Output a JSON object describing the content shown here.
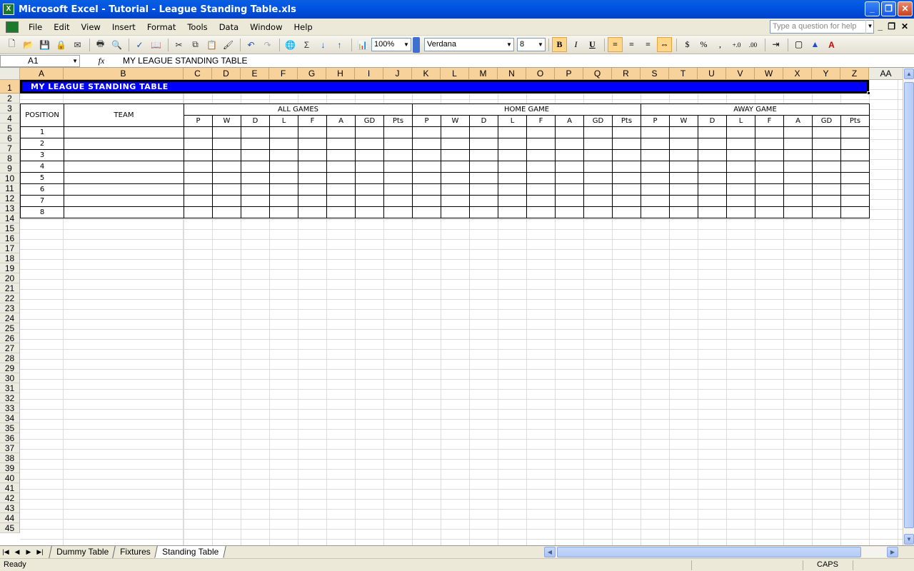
{
  "window": {
    "title": "Microsoft Excel - Tutorial - League Standing Table.xls",
    "app_icon_glyph": "X"
  },
  "menu": {
    "items": [
      "File",
      "Edit",
      "View",
      "Insert",
      "Format",
      "Tools",
      "Data",
      "Window",
      "Help"
    ],
    "help_placeholder": "Type a question for help"
  },
  "toolbar": {
    "zoom": "100%",
    "font_name": "Verdana",
    "font_size": "8",
    "bold": "B",
    "italic": "I",
    "underline": "U",
    "currency": "$",
    "percent": "%",
    "comma": ",",
    "increase_decimal": "+.0",
    "decrease_decimal": ".00",
    "sigma": "Σ"
  },
  "formula_bar": {
    "cell_ref": "A1",
    "fx": "fx",
    "content": "MY LEAGUE STANDING TABLE"
  },
  "sheet": {
    "columns": [
      "A",
      "B",
      "C",
      "D",
      "E",
      "F",
      "G",
      "H",
      "I",
      "J",
      "K",
      "L",
      "M",
      "N",
      "O",
      "P",
      "Q",
      "R",
      "S",
      "T",
      "U",
      "V",
      "W",
      "X",
      "Y",
      "Z",
      "AA"
    ],
    "row_count": 45,
    "title": "MY LEAGUE STANDING TABLE",
    "header_position": "POSITION",
    "header_team": "TEAM",
    "groups": [
      "ALL GAMES",
      "HOME GAME",
      "AWAY GAME"
    ],
    "stat_headers": [
      "P",
      "W",
      "D",
      "L",
      "F",
      "A",
      "GD",
      "Pts"
    ],
    "positions": [
      "1",
      "2",
      "3",
      "4",
      "5",
      "6",
      "7",
      "8"
    ]
  },
  "tabs": {
    "sheets": [
      "Dummy Table",
      "Fixtures",
      "Standing Table"
    ],
    "active": "Standing Table"
  },
  "status": {
    "left": "Ready",
    "caps": "CAPS"
  },
  "colors": {
    "title_bar": "#0054e3",
    "banner": "#0000ff",
    "header_highlight": "#f7d29a"
  }
}
